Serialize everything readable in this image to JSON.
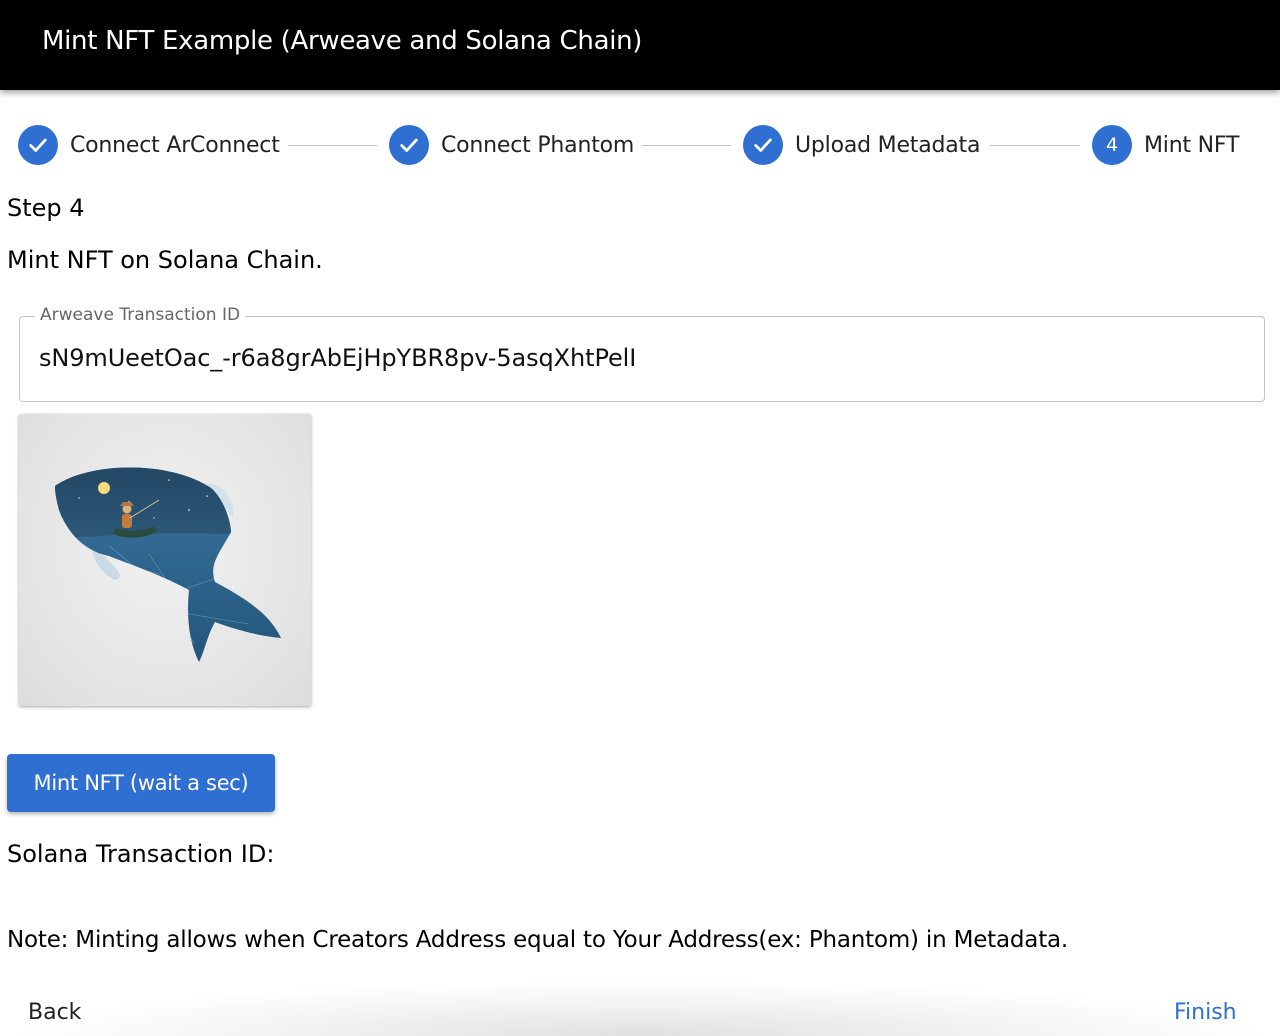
{
  "appbar": {
    "title": "Mint NFT Example (Arweave and Solana Chain)"
  },
  "stepper": {
    "steps": [
      {
        "label": "Connect ArConnect",
        "state": "completed",
        "icon": "check-icon"
      },
      {
        "label": "Connect Phantom",
        "state": "completed",
        "icon": "check-icon"
      },
      {
        "label": "Upload Metadata",
        "state": "completed",
        "icon": "check-icon"
      },
      {
        "label": "Mint NFT",
        "state": "active",
        "number": "4"
      }
    ]
  },
  "content": {
    "step_heading": "Step 4",
    "step_description": "Mint NFT on Solana Chain.",
    "arweave_field": {
      "label": "Arweave Transaction ID",
      "value": "sN9mUeetOac_-r6a8grAbEjHpYBR8pv-5asqXhtPelI"
    },
    "nft_image": {
      "icon": "fish-fisherman-artwork"
    },
    "mint_button_label": "Mint NFT (wait a sec)",
    "solana_tx_label": "Solana Transaction ID:",
    "note": "Note: Minting allows when Creators Address equal to Your Address(ex: Phantom) in Metadata."
  },
  "footer": {
    "back_label": "Back",
    "finish_label": "Finish"
  },
  "colors": {
    "appbar": "#000000",
    "primary": "#2f6fd1",
    "connector": "#bdbdbd",
    "text": "#000000"
  }
}
